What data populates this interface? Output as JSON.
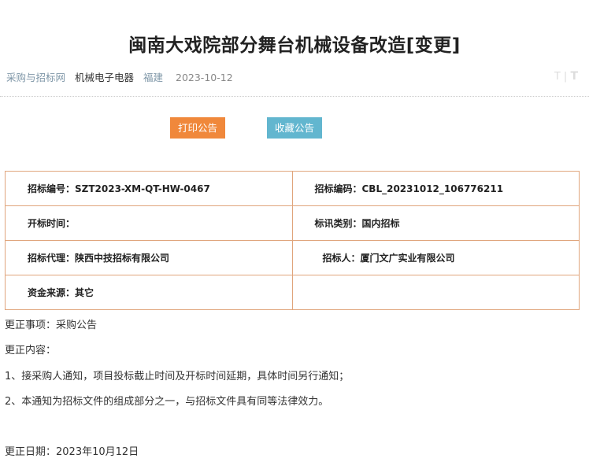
{
  "title": "闽南大戏院部分舞台机械设备改造[变更]",
  "meta": {
    "site": "采购与招标网",
    "category": "机械电子电器",
    "region": "福建",
    "date": "2023-10-12"
  },
  "font_toggle": {
    "small": "T",
    "separator": "|",
    "large": "T"
  },
  "buttons": {
    "print": "打印公告",
    "collect": "收藏公告"
  },
  "info_table": {
    "bid_number": "招标编号：SZT2023-XM-QT-HW-0467",
    "bid_code": "招标编码：CBL_20231012_106776211",
    "open_time": "开标时间：",
    "notice_type": "标讯类别：国内招标",
    "agent": "招标代理：陕西中技招标有限公司",
    "tenderer": "招标人：厦门文广实业有限公司",
    "fund_source": "资金来源：其它"
  },
  "content": {
    "correction_item": "更正事项：采购公告",
    "correction_content_label": "更正内容：",
    "item1": "1、接采购人通知，项目投标截止时间及开标时间延期，具体时间另行通知；",
    "item2": "2、本通知为招标文件的组成部分之一，与招标文件具有同等法律效力。",
    "correction_date": "更正日期：2023年10月12日"
  }
}
